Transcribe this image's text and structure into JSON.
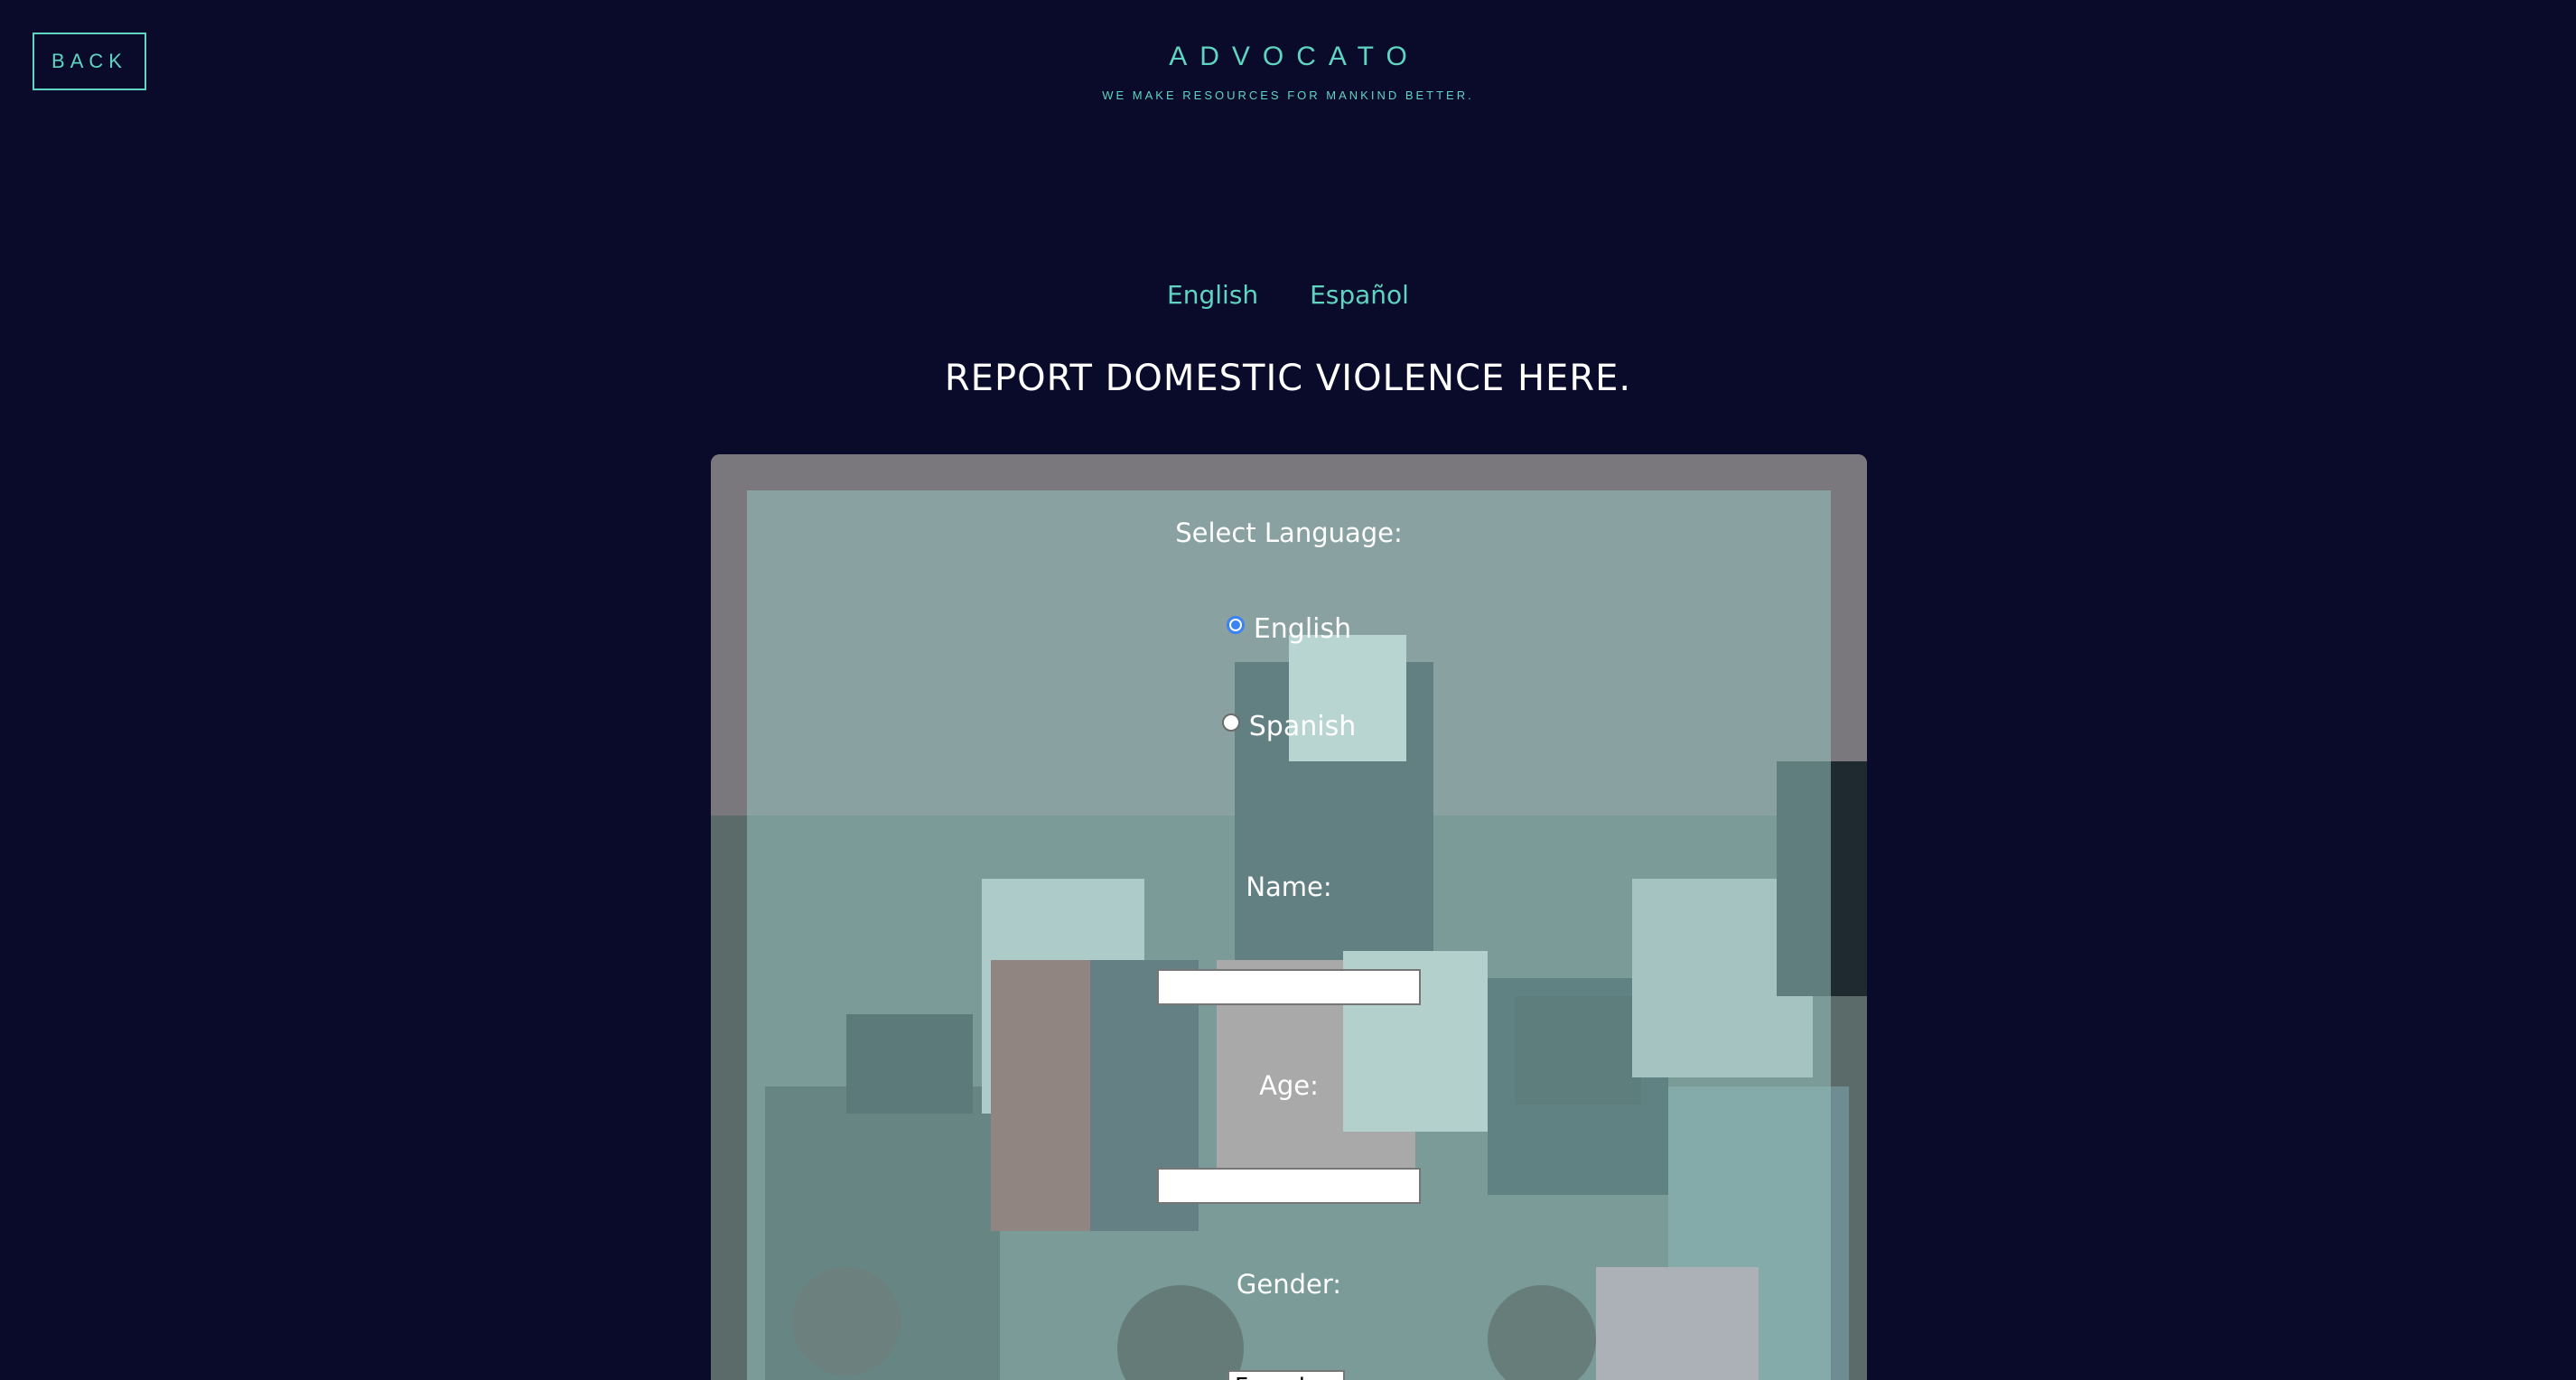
{
  "header": {
    "back_label": "BACK",
    "brand_title": "ADVOCATO",
    "brand_tagline": "WE MAKE RESOURCES FOR MANKIND BETTER."
  },
  "language_links": {
    "english": "English",
    "spanish": "Español"
  },
  "headline": "REPORT DOMESTIC VIOLENCE HERE.",
  "form": {
    "select_language_label": "Select Language:",
    "radio_english": "English",
    "radio_spanish": "Spanish",
    "selected_language": "English",
    "name_label": "Name:",
    "name_value": "",
    "age_label": "Age:",
    "age_value": "",
    "gender_label": "Gender:",
    "gender_value": "Female"
  },
  "colors": {
    "background": "#0a0b2b",
    "accent": "#5fd4c1",
    "radio_selected": "#3b82f6"
  }
}
